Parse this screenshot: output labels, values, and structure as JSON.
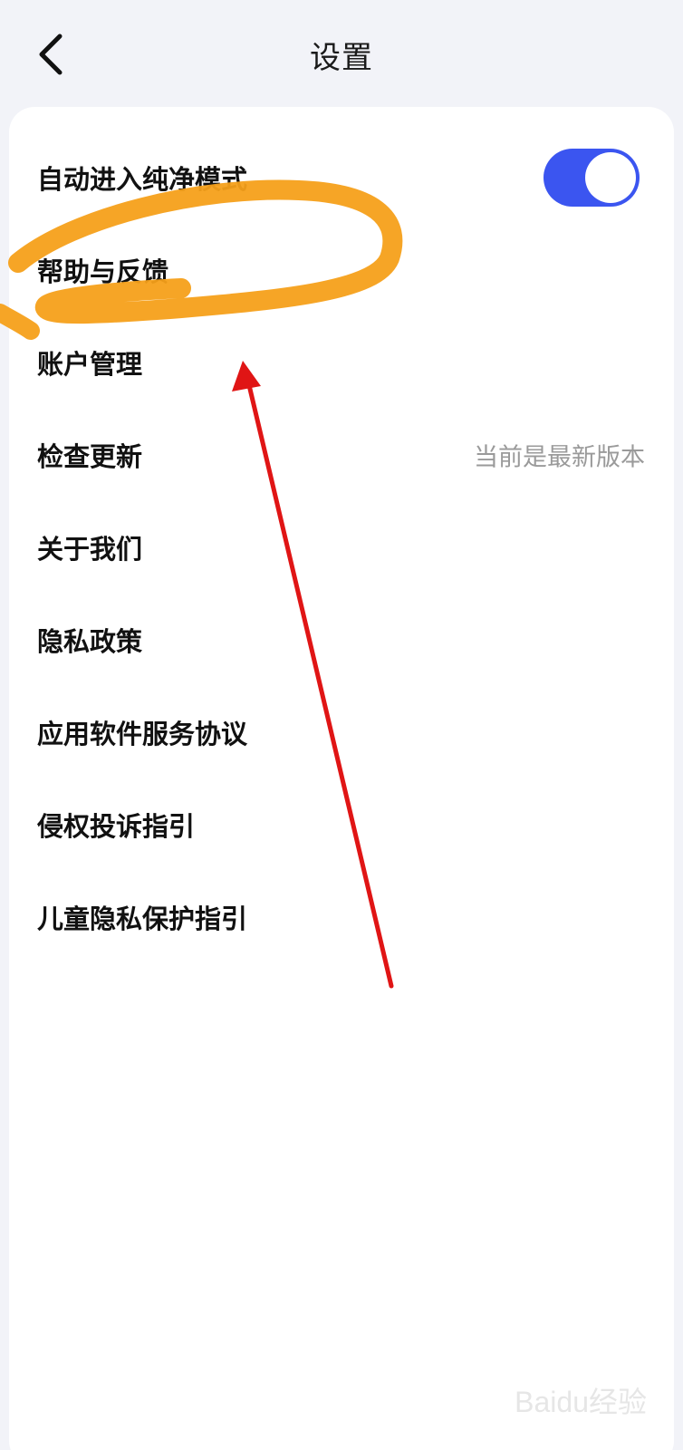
{
  "header": {
    "title": "设置",
    "back_icon": "chevron-left-icon"
  },
  "settings": {
    "auto_pure_mode": {
      "label": "自动进入纯净模式",
      "toggle_on": true,
      "toggle_color": "#3b55f0"
    },
    "items": [
      {
        "label": "帮助与反馈",
        "value": ""
      },
      {
        "label": "账户管理",
        "value": ""
      },
      {
        "label": "检查更新",
        "value": "当前是最新版本"
      },
      {
        "label": "关于我们",
        "value": ""
      },
      {
        "label": "隐私政策",
        "value": ""
      },
      {
        "label": "应用软件服务协议",
        "value": ""
      },
      {
        "label": "侵权投诉指引",
        "value": ""
      },
      {
        "label": "儿童隐私保护指引",
        "value": ""
      }
    ]
  },
  "annotations": {
    "highlight_color": "#f5a01a",
    "arrow_color": "#e01515"
  },
  "watermark": {
    "text": "Baidu经验"
  }
}
